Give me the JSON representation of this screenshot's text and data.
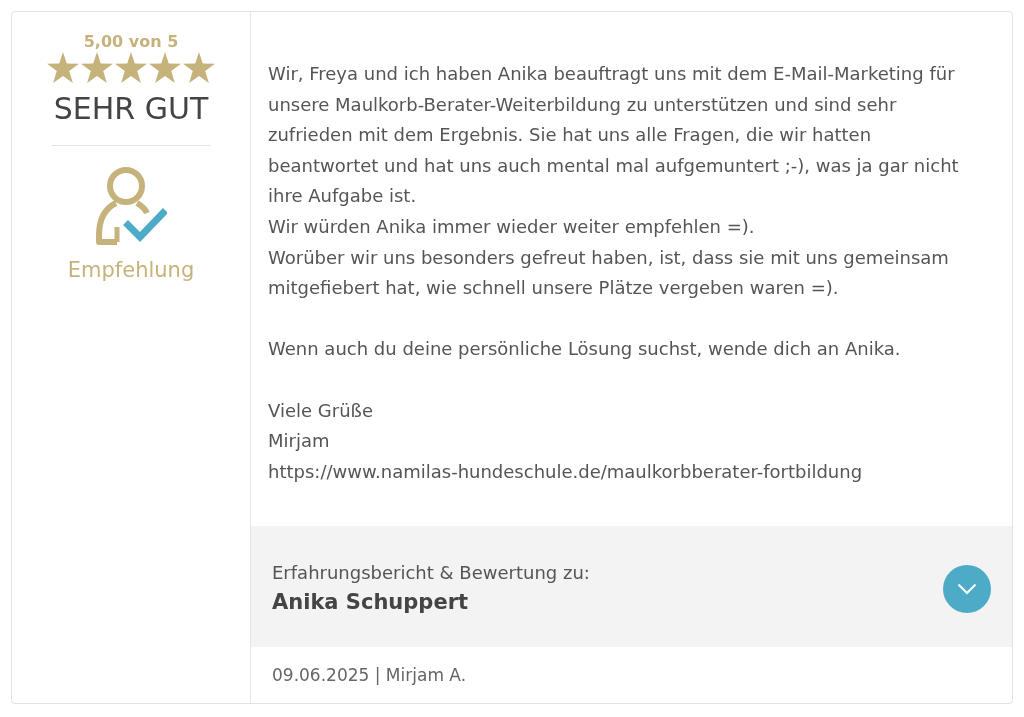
{
  "rating": {
    "score": "5,00 von 5",
    "stars": 5,
    "verdict": "SEHR GUT",
    "recommendation": "Empfehlung"
  },
  "review": {
    "paragraphs": [
      {
        "lines": [
          "Wir, Freya und ich haben Anika beauftragt uns mit dem E-Mail-Marketing für unsere Maulkorb-Berater-Weiterbildung zu unterstützen und sind sehr zufrieden mit dem Ergebnis. Sie hat uns alle Fragen, die wir hatten beantwortet und hat uns auch mental mal aufgemuntert ;-), was ja gar nicht ihre Aufgabe ist.",
          "Wir würden Anika immer wieder weiter empfehlen =).",
          "Worüber wir uns besonders gefreut haben, ist, dass sie mit uns gemeinsam mitgefiebert hat, wie schnell unsere Plätze vergeben waren =)."
        ]
      },
      {
        "lines": [
          "Wenn auch du deine persönliche Lösung suchst, wende dich an Anika."
        ]
      },
      {
        "lines": [
          "Viele Grüße",
          "Mirjam",
          "https://www.namilas-hundeschule.de/maulkorbberater-fortbildung"
        ]
      }
    ]
  },
  "subject": {
    "caption": "Erfahrungsbericht & Bewertung zu:",
    "name": "Anika Schuppert",
    "expanded": false
  },
  "footer": {
    "meta": "09.06.2025 | Mirjam A."
  }
}
